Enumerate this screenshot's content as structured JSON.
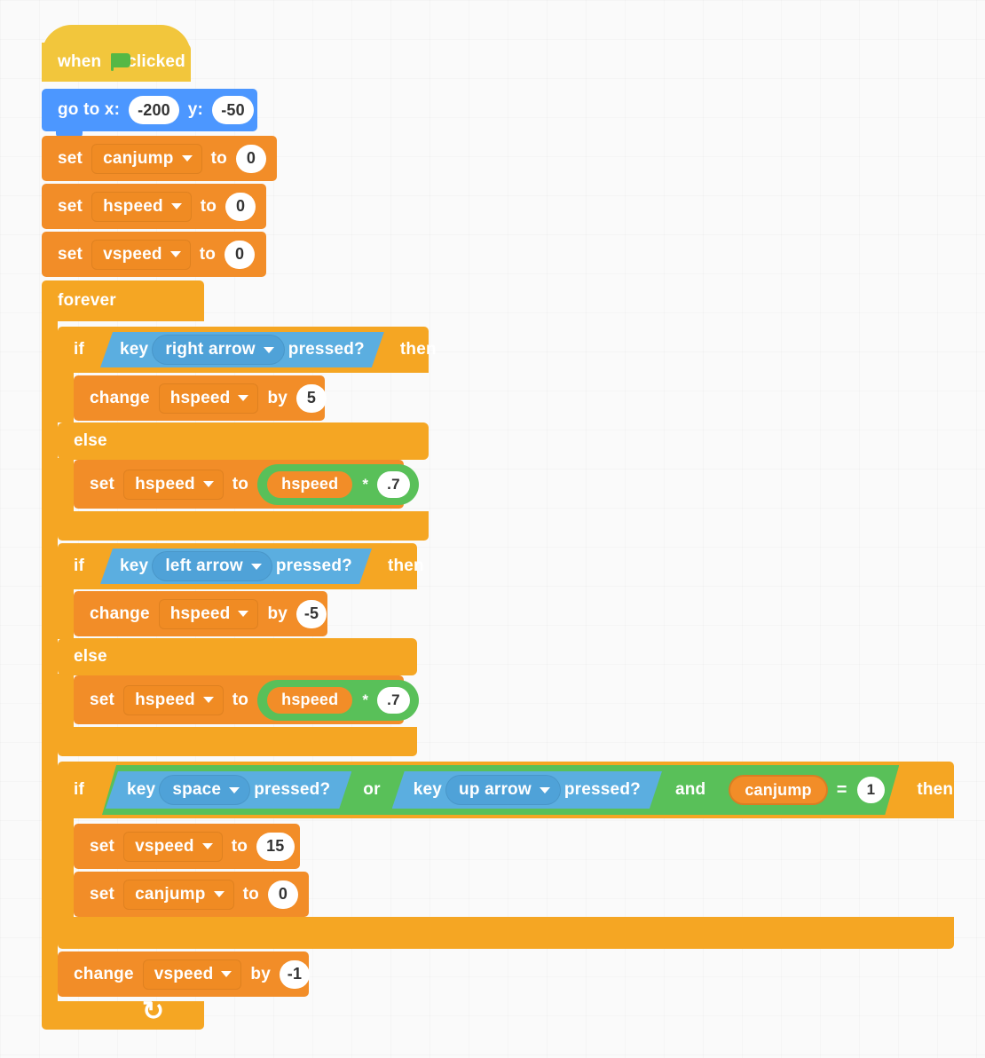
{
  "workspace": {
    "background_color": "#fafafa"
  },
  "palette": {
    "events": "#F2C63C",
    "motion": "#4C97FF",
    "variables": "#F28D28",
    "control": "#F5A623",
    "sensing": "#5BAEE0",
    "operators": "#59C059"
  },
  "script": {
    "hat": {
      "word_when": "when",
      "icon": "green-flag-icon",
      "word_clicked": "clicked"
    },
    "goto": {
      "label_x": "go to x:",
      "value_x": "-200",
      "label_y": "y:",
      "value_y": "-50"
    },
    "set_canjump_init": {
      "word_set": "set",
      "variable": "canjump",
      "word_to": "to",
      "value": "0"
    },
    "set_hspeed_init": {
      "word_set": "set",
      "variable": "hspeed",
      "word_to": "to",
      "value": "0"
    },
    "set_vspeed_init": {
      "word_set": "set",
      "variable": "vspeed",
      "word_to": "to",
      "value": "0"
    },
    "forever": {
      "label": "forever",
      "loop_icon": "loop-arrow-icon"
    },
    "if_right": {
      "word_if": "if",
      "word_then": "then",
      "word_else": "else",
      "condition": {
        "word_key": "key",
        "key_name": "right arrow",
        "word_pressed": "pressed?"
      },
      "body": {
        "word_change": "change",
        "variable": "hspeed",
        "word_by": "by",
        "value": "5"
      },
      "else_body": {
        "word_set": "set",
        "variable": "hspeed",
        "word_to": "to",
        "operand_left": "hspeed",
        "operator": "*",
        "operand_right": ".7"
      }
    },
    "if_left": {
      "word_if": "if",
      "word_then": "then",
      "word_else": "else",
      "condition": {
        "word_key": "key",
        "key_name": "left arrow",
        "word_pressed": "pressed?"
      },
      "body": {
        "word_change": "change",
        "variable": "hspeed",
        "word_by": "by",
        "value": "-5"
      },
      "else_body": {
        "word_set": "set",
        "variable": "hspeed",
        "word_to": "to",
        "operand_left": "hspeed",
        "operator": "*",
        "operand_right": ".7"
      }
    },
    "if_jump": {
      "word_if": "if",
      "word_then": "then",
      "condition": {
        "key_space": {
          "word_key": "key",
          "key_name": "space",
          "word_pressed": "pressed?"
        },
        "word_or": "or",
        "key_up": {
          "word_key": "key",
          "key_name": "up arrow",
          "word_pressed": "pressed?"
        },
        "word_and": "and",
        "equals": {
          "variable": "canjump",
          "operator": "=",
          "value": "1"
        }
      },
      "body": [
        {
          "word_set": "set",
          "variable": "vspeed",
          "word_to": "to",
          "value": "15"
        },
        {
          "word_set": "set",
          "variable": "canjump",
          "word_to": "to",
          "value": "0"
        }
      ]
    },
    "change_vspeed": {
      "word_change": "change",
      "variable": "vspeed",
      "word_by": "by",
      "value": "-1"
    }
  }
}
